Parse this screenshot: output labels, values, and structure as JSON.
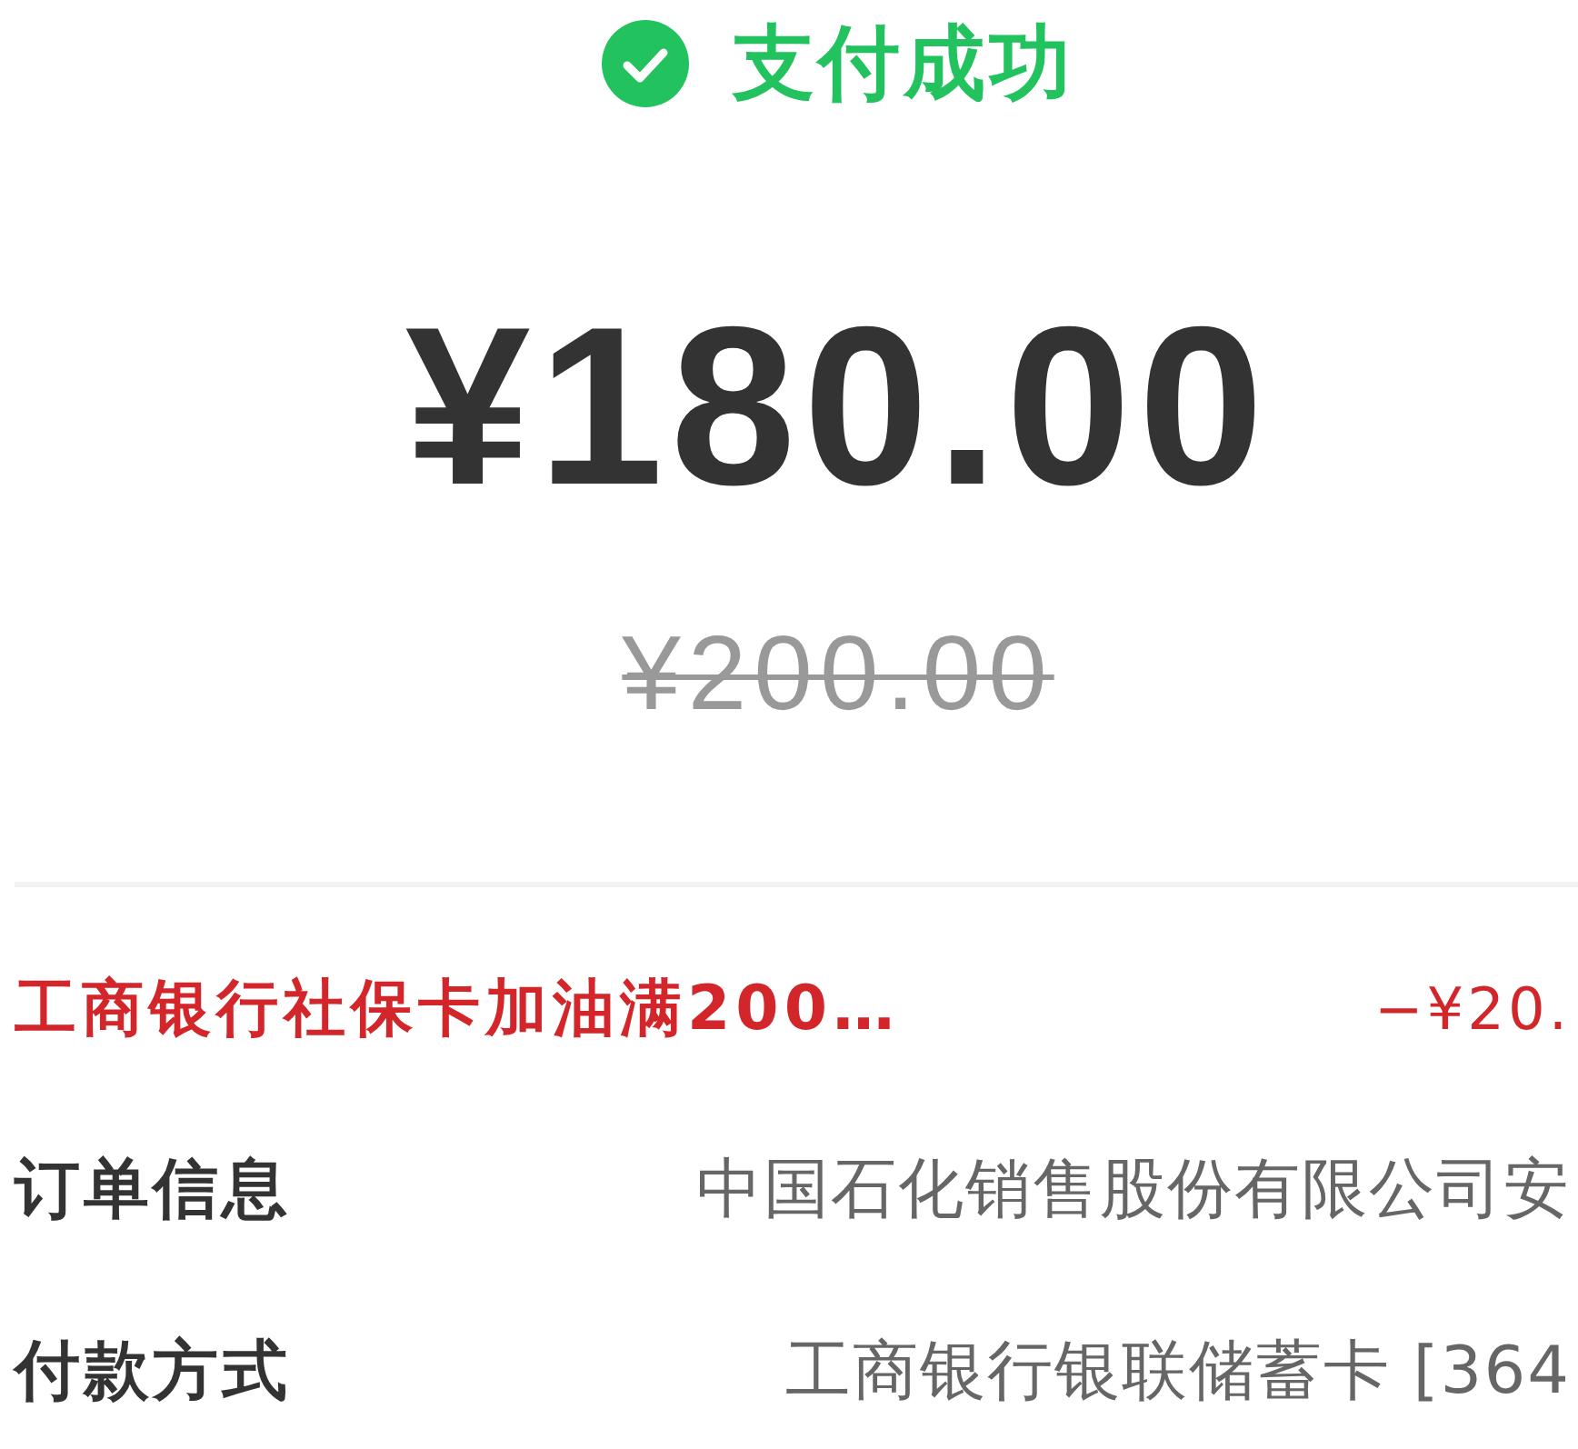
{
  "header": {
    "success": true,
    "title": "支付成功"
  },
  "amount": {
    "paid": "¥180.00",
    "original": "¥200.00"
  },
  "discount": {
    "label": "工商银行社保卡加油满200…",
    "value": "−¥20."
  },
  "details": [
    {
      "label": "订单信息",
      "value": "中国石化销售股份有限公司安"
    },
    {
      "label": "付款方式",
      "value": "工商银行银联储蓄卡 [364"
    }
  ]
}
